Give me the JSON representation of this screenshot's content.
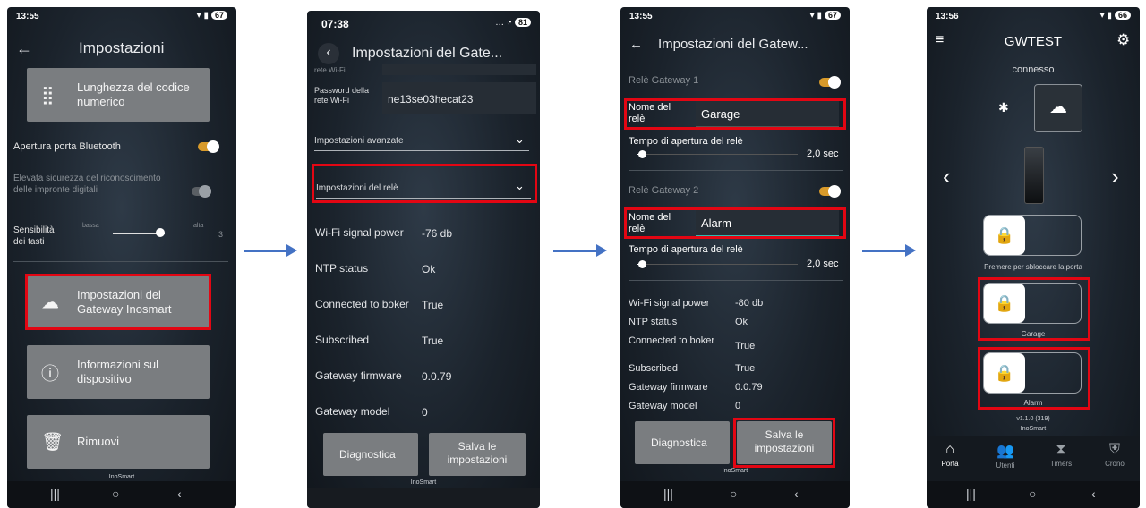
{
  "phone1": {
    "status_time": "13:55",
    "battery": "67",
    "header_title": "Impostazioni",
    "tile_code_length": "Lunghezza del codice numerico",
    "bt_door_label": "Apertura porta Bluetooth",
    "fingerprint_label": "Elevata sicurezza del riconoscimento delle impronte digitali",
    "sensitivity_label": "Sensibilità dei tasti",
    "sens_low": "bassa",
    "sens_high": "alta",
    "sens_value": "3",
    "tile_gateway": "Impostazioni del Gateway Inosmart",
    "tile_info": "Informazioni sul dispositivo",
    "tile_remove": "Rimuovi",
    "brand": "InoSmart"
  },
  "phone2": {
    "status_time": "07:38",
    "battery": "81",
    "header_title": "Impostazioni del Gate...",
    "wifi_partial": "rete Wi-Fi",
    "password_label": "Password della rete Wi-Fi",
    "password_value": "ne13se03hecat23",
    "advanced": "Impostazioni avanzate",
    "relay_settings": "Impostazioni del relè",
    "info": [
      {
        "k": "Wi-Fi signal power",
        "v": "-76 db"
      },
      {
        "k": "NTP status",
        "v": "Ok"
      },
      {
        "k": "Connected to boker",
        "v": "True"
      },
      {
        "k": "Subscribed",
        "v": "True"
      },
      {
        "k": "Gateway firmware",
        "v": "0.0.79"
      },
      {
        "k": "Gateway model",
        "v": "0"
      }
    ],
    "btn_diag": "Diagnostica",
    "btn_save": "Salva le impostazioni",
    "brand": "InoSmart"
  },
  "phone3": {
    "status_time": "13:55",
    "battery": "67",
    "header_title": "Impostazioni del Gatew...",
    "relay1_title": "Relè Gateway 1",
    "relay_name_label": "Nome del relè",
    "relay1_name": "Garage",
    "open_time_label": "Tempo di apertura del relè",
    "open_time_value": "2,0 sec",
    "relay2_title": "Relè Gateway 2",
    "relay2_name": "Alarm",
    "info": [
      {
        "k": "Wi-Fi signal power",
        "v": "-80 db"
      },
      {
        "k": "NTP status",
        "v": "Ok"
      },
      {
        "k": "Connected to boker",
        "v": "True"
      },
      {
        "k": "Subscribed",
        "v": "True"
      },
      {
        "k": "Gateway firmware",
        "v": "0.0.79"
      },
      {
        "k": "Gateway model",
        "v": "0"
      }
    ],
    "btn_diag": "Diagnostica",
    "btn_save": "Salva le impostazioni",
    "brand": "InoSmart"
  },
  "phone4": {
    "status_time": "13:56",
    "battery": "66",
    "header_title": "GWTEST",
    "connection": "connesso",
    "press_unlock": "Premere per sbloccare la porta",
    "garage": "Garage",
    "alarm": "Alarm",
    "version": "v1.1.0 (319)",
    "brand": "InoSmart",
    "tabs": [
      "Porta",
      "Utenti",
      "Timers",
      "Crono"
    ]
  },
  "colors": {
    "highlight": "#e30613",
    "arrow": "#4472c4",
    "toggle": "#d89a2a"
  }
}
